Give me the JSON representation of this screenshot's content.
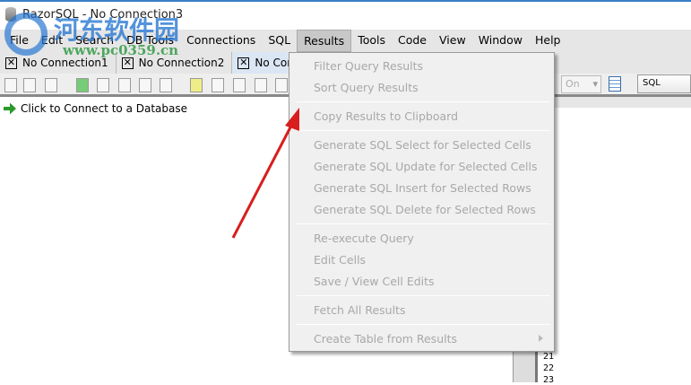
{
  "window": {
    "title": "RazorSQL - No Connection3"
  },
  "menubar": [
    "File",
    "Edit",
    "Search",
    "DB Tools",
    "Connections",
    "SQL",
    "Results",
    "Tools",
    "Code",
    "View",
    "Window",
    "Help"
  ],
  "tabs": [
    "No Connection1",
    "No Connection2",
    "No Con"
  ],
  "sidebar": {
    "connect_label": "Click to Connect to a Database"
  },
  "toolbar": {
    "autocommit_value": "On",
    "language_value": "SQL"
  },
  "editor": {
    "line_numbers": [
      "21",
      "22",
      "23"
    ]
  },
  "results_menu": {
    "groups": [
      [
        "Filter Query Results",
        "Sort Query Results"
      ],
      [
        "Copy Results to Clipboard"
      ],
      [
        "Generate SQL Select for Selected Cells",
        "Generate SQL Update for Selected Cells",
        "Generate SQL Insert for Selected Rows",
        "Generate SQL Delete for Selected Rows"
      ],
      [
        "Re-execute Query",
        "Edit Cells",
        "Save / View Cell Edits"
      ],
      [
        "Fetch All Results"
      ],
      [
        "Create Table from Results"
      ]
    ]
  },
  "watermark": {
    "text": "河东软件园",
    "url": "www.pc0359.cn"
  },
  "colors": {
    "arrow": "#d81e1e",
    "menu_bg": "#f0f0f0",
    "disabled_text": "#a8a8a8"
  }
}
